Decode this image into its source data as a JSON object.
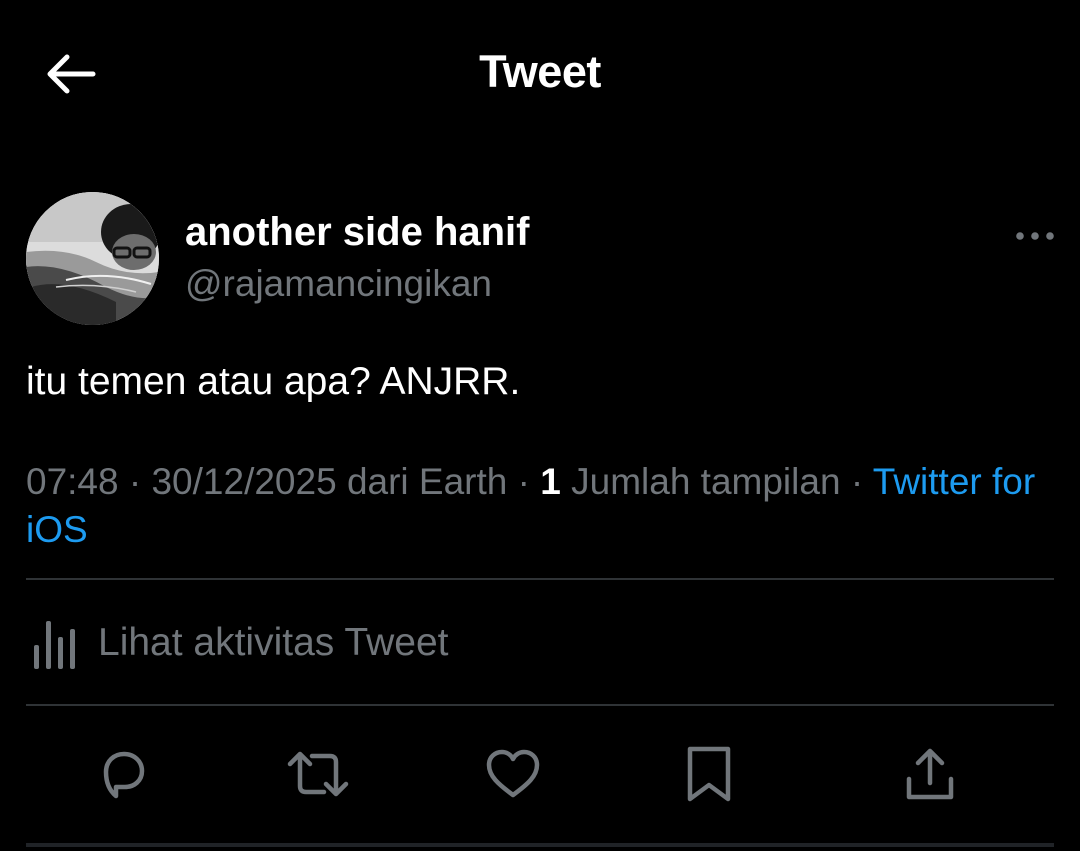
{
  "header": {
    "title": "Tweet",
    "back_icon": "arrow-left-icon"
  },
  "author": {
    "display_name": "another side hanif",
    "handle": "@rajamancingikan"
  },
  "tweet": {
    "text": "itu temen atau apa? ANJRR.",
    "time": "07:48",
    "date": "30/12/2025",
    "location": "dari Earth",
    "view_count": "1",
    "view_label": "Jumlah tampilan",
    "source": "Twitter for iOS",
    "separator": "·"
  },
  "activity": {
    "label": "Lihat aktivitas Tweet",
    "icon": "analytics-bars-icon"
  },
  "actions": [
    {
      "name": "reply",
      "icon": "reply-icon"
    },
    {
      "name": "retweet",
      "icon": "retweet-icon"
    },
    {
      "name": "like",
      "icon": "heart-icon"
    },
    {
      "name": "bookmark",
      "icon": "bookmark-icon"
    },
    {
      "name": "share",
      "icon": "share-icon"
    }
  ],
  "colors": {
    "background": "#000000",
    "primary_text": "#ffffff",
    "secondary_text": "#71767b",
    "link": "#1d9bf0",
    "divider": "#2f3336"
  }
}
